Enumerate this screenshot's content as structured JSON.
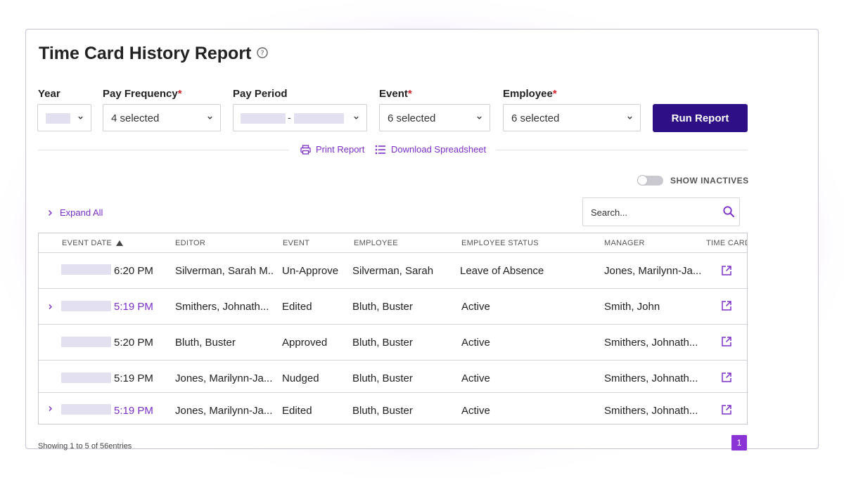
{
  "report": {
    "title": "Time Card History Report"
  },
  "filters": {
    "year": {
      "label": "Year",
      "value": ""
    },
    "pay_frequency": {
      "label": "Pay Frequency",
      "required": "*",
      "value": "4 selected"
    },
    "pay_period": {
      "label": "Pay Period",
      "separator": "-"
    },
    "event": {
      "label": "Event",
      "required": "*",
      "value": "6 selected"
    },
    "employee": {
      "label": "Employee",
      "required": "*",
      "value": "6 selected"
    },
    "run_label": "Run Report"
  },
  "actions": {
    "print": "Print Report",
    "download": "Download Spreadsheet"
  },
  "toggle": {
    "label": "SHOW INACTIVES",
    "on": false
  },
  "expand_all": "Expand All",
  "search": {
    "placeholder": "Search..."
  },
  "table": {
    "columns": [
      "EVENT DATE",
      "EDITOR",
      "EVENT",
      "EMPLOYEE",
      "EMPLOYEE STATUS",
      "MANAGER",
      "TIME CARD"
    ],
    "rows": [
      {
        "time": "6:20 PM",
        "editor": "Silverman, Sarah M..",
        "event": "Un-Approve",
        "employee": "Silverman, Sarah",
        "status": "Leave of Absence",
        "manager": "Jones, Marilynn-Ja...",
        "expandable": false
      },
      {
        "time": "5:19 PM",
        "editor": "Smithers, Johnath...",
        "event": "Edited",
        "employee": "Bluth, Buster",
        "status": "Active",
        "manager": "Smith, John",
        "expandable": true
      },
      {
        "time": "5:20 PM",
        "editor": "Bluth, Buster",
        "event": "Approved",
        "employee": "Bluth, Buster",
        "status": "Active",
        "manager": "Smithers, Johnath...",
        "expandable": false
      },
      {
        "time": "5:19 PM",
        "editor": "Jones, Marilynn-Ja...",
        "event": "Nudged",
        "employee": "Bluth, Buster",
        "status": "Active",
        "manager": "Smithers, Johnath...",
        "expandable": false
      },
      {
        "time": "5:19 PM",
        "editor": "Jones, Marilynn-Ja...",
        "event": "Edited",
        "employee": "Bluth, Buster",
        "status": "Active",
        "manager": "Smithers, Johnath...",
        "expandable": true
      }
    ]
  },
  "footer": {
    "summary": "Showing 1 to 5 of 56entries",
    "page": "1"
  },
  "colors": {
    "accent": "#7b2ec8",
    "primary_button": "#2e0f86",
    "required": "#d0242a",
    "page_button": "#8a34d6"
  }
}
